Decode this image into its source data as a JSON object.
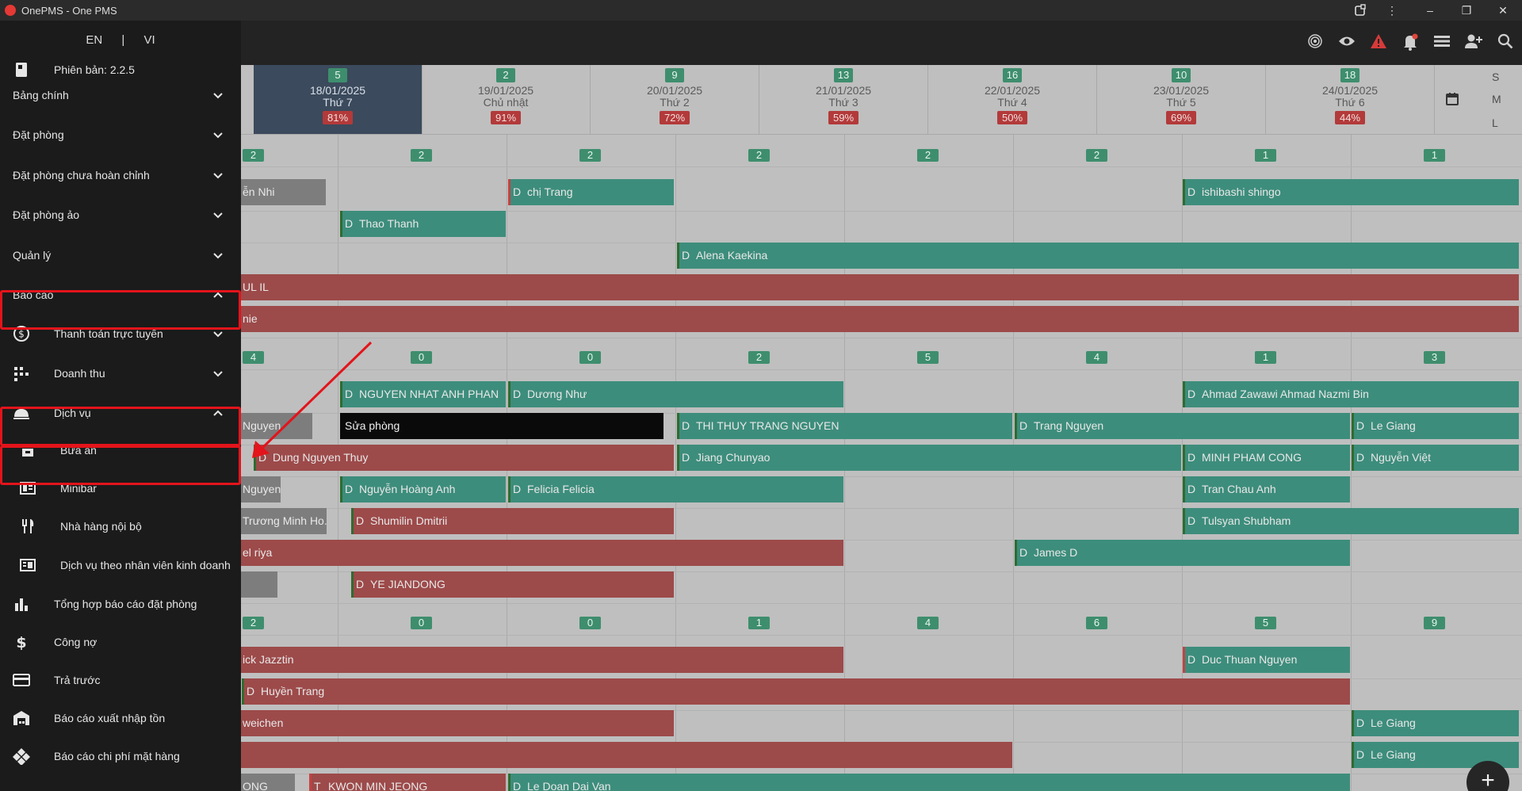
{
  "window": {
    "title": "OnePMS - One PMS"
  },
  "sidebar": {
    "lang_en": "EN",
    "lang_sep": "|",
    "lang_vi": "VI",
    "version": "Phiên bản: 2.2.5",
    "items": [
      {
        "label": "Bảng chính",
        "icon": "",
        "chevron": "down"
      },
      {
        "label": "Đặt phòng",
        "icon": "",
        "chevron": "down"
      },
      {
        "label": "Đặt phòng chưa hoàn chỉnh",
        "icon": "",
        "chevron": "down"
      },
      {
        "label": "Đặt phòng ảo",
        "icon": "",
        "chevron": "down"
      },
      {
        "label": "Quản lý",
        "icon": "",
        "chevron": "down"
      },
      {
        "label": "Báo cáo",
        "icon": "",
        "chevron": "up"
      },
      {
        "label": "Thanh toán trực tuyến",
        "icon": "dollar-circle-icon",
        "chevron": "down"
      },
      {
        "label": "Doanh thu",
        "icon": "grid-dots-icon",
        "chevron": "down"
      },
      {
        "label": "Dịch vụ",
        "icon": "cloche-icon",
        "chevron": "up"
      },
      {
        "label": "Bữa ăn",
        "icon": "store-icon",
        "chevron": ""
      },
      {
        "label": "Minibar",
        "icon": "minibar-icon",
        "chevron": ""
      },
      {
        "label": "Nhà hàng nội bộ",
        "icon": "utensils-icon",
        "chevron": ""
      },
      {
        "label": "Dịch vụ theo nhân viên kinh doanh",
        "icon": "reader-icon",
        "chevron": ""
      },
      {
        "label": "Tổng hợp báo cáo đặt phòng",
        "icon": "bar-chart-icon",
        "chevron": ""
      },
      {
        "label": "Công nợ",
        "icon": "dollar-icon",
        "chevron": ""
      },
      {
        "label": "Trả trước",
        "icon": "credit-card-icon",
        "chevron": ""
      },
      {
        "label": "Báo cáo xuất nhập tồn",
        "icon": "warehouse-icon",
        "chevron": ""
      },
      {
        "label": "Báo cáo chi phí mặt hàng",
        "icon": "diamond-tiles-icon",
        "chevron": ""
      }
    ]
  },
  "header_icons": [
    "fingerprint-icon",
    "eye-icon",
    "warning-icon",
    "bell-icon",
    "list-icon",
    "add-user-icon",
    "search-icon"
  ],
  "calendar": {
    "dates": [
      {
        "count": "5",
        "date": "18/01/2025",
        "day": "Thứ 7",
        "pct": "81%",
        "today": true
      },
      {
        "count": "2",
        "date": "19/01/2025",
        "day": "Chủ nhật",
        "pct": "91%"
      },
      {
        "count": "9",
        "date": "20/01/2025",
        "day": "Thứ 2",
        "pct": "72%"
      },
      {
        "count": "13",
        "date": "21/01/2025",
        "day": "Thứ 3",
        "pct": "59%"
      },
      {
        "count": "16",
        "date": "22/01/2025",
        "day": "Thứ 4",
        "pct": "50%"
      },
      {
        "count": "10",
        "date": "23/01/2025",
        "day": "Thứ 5",
        "pct": "69%"
      },
      {
        "count": "18",
        "date": "24/01/2025",
        "day": "Thứ 6",
        "pct": "44%"
      }
    ],
    "sizes": [
      "S",
      "M",
      "L"
    ],
    "group_counts": [
      [
        "2",
        "2",
        "2",
        "2",
        "2",
        "2",
        "1",
        "1"
      ],
      [
        "4",
        "0",
        "0",
        "2",
        "5",
        "4",
        "1",
        "3"
      ],
      [
        "2",
        "0",
        "0",
        "1",
        "4",
        "6",
        "5",
        "9"
      ]
    ],
    "bookings": [
      {
        "text": "ễn Nhi",
        "mark": "",
        "color": "gray"
      },
      {
        "text": "chị Trang",
        "mark": "D",
        "color": "teal",
        "stripe": "red"
      },
      {
        "text": "ishibashi shingo",
        "mark": "D",
        "color": "teal",
        "stripe": "green"
      },
      {
        "text": "Thao Thanh",
        "mark": "D",
        "color": "teal",
        "stripe": "green"
      },
      {
        "text": "Alena Kaekina",
        "mark": "D",
        "color": "teal",
        "stripe": "green"
      },
      {
        "text": "UL IL",
        "mark": "",
        "color": "red"
      },
      {
        "text": "nie",
        "mark": "",
        "color": "red"
      },
      {
        "text": "NGUYEN NHAT ANH PHAN",
        "mark": "D",
        "color": "teal",
        "stripe": "green"
      },
      {
        "text": "Dương Như",
        "mark": "D",
        "color": "teal",
        "stripe": "green"
      },
      {
        "text": "Ahmad Zawawi Ahmad Nazmi Bin",
        "mark": "D",
        "color": "teal",
        "stripe": "green"
      },
      {
        "text": "Nguyen",
        "mark": "",
        "color": "gray"
      },
      {
        "text": "Sửa phòng",
        "mark": "",
        "color": "black"
      },
      {
        "text": "THI THUY TRANG NGUYEN",
        "mark": "D",
        "color": "teal",
        "stripe": "green"
      },
      {
        "text": "Trang Nguyen",
        "mark": "D",
        "color": "teal",
        "stripe": "green"
      },
      {
        "text": "Le Giang",
        "mark": "D",
        "color": "teal",
        "stripe": "green"
      },
      {
        "text": "Dung Nguyen Thuy",
        "mark": "D",
        "color": "red",
        "stripe": "green"
      },
      {
        "text": "Jiang Chunyao",
        "mark": "D",
        "color": "teal",
        "stripe": "green"
      },
      {
        "text": "MINH PHAM CONG",
        "mark": "D",
        "color": "teal",
        "stripe": "green"
      },
      {
        "text": "Nguyễn Việt",
        "mark": "D",
        "color": "teal",
        "stripe": "green"
      },
      {
        "text": "Nguyen",
        "mark": "",
        "color": "gray"
      },
      {
        "text": "Nguyễn Hoàng Anh",
        "mark": "D",
        "color": "teal",
        "stripe": "green"
      },
      {
        "text": "Felicia Felicia",
        "mark": "D",
        "color": "teal",
        "stripe": "green"
      },
      {
        "text": "Tran Chau Anh",
        "mark": "D",
        "color": "teal",
        "stripe": "green"
      },
      {
        "text": "Trương Minh Ho...",
        "mark": "",
        "color": "gray"
      },
      {
        "text": "Shumilin Dmitrii",
        "mark": "D",
        "color": "red",
        "stripe": "green"
      },
      {
        "text": "Tulsyan Shubham",
        "mark": "D",
        "color": "teal",
        "stripe": "green"
      },
      {
        "text": "el riya",
        "mark": "",
        "color": "red"
      },
      {
        "text": "James D",
        "mark": "D",
        "color": "teal",
        "stripe": "green"
      },
      {
        "text": "",
        "mark": "",
        "color": "gray"
      },
      {
        "text": "YE JIANDONG",
        "mark": "D",
        "color": "red",
        "stripe": "green"
      },
      {
        "text": "ick Jazztin",
        "mark": "",
        "color": "red"
      },
      {
        "text": "Duc Thuan Nguyen",
        "mark": "D",
        "color": "teal",
        "stripe": "red"
      },
      {
        "text": "Huyền Trang",
        "mark": "D",
        "color": "red",
        "stripe": "green"
      },
      {
        "text": "weichen",
        "mark": "",
        "color": "red"
      },
      {
        "text": "Le Giang",
        "mark": "D",
        "color": "teal",
        "stripe": "green"
      },
      {
        "text": "",
        "mark": "",
        "color": "red"
      },
      {
        "text": "Le Giang",
        "mark": "D",
        "color": "teal",
        "stripe": "green"
      },
      {
        "text": "ONG",
        "mark": "",
        "color": "gray"
      },
      {
        "text": "KWON MIN JEONG",
        "mark": "T",
        "color": "red",
        "stripe": "red"
      },
      {
        "text": "Le Doan Dai Van",
        "mark": "D",
        "color": "teal",
        "stripe": "green"
      }
    ]
  },
  "fab_label": "+"
}
